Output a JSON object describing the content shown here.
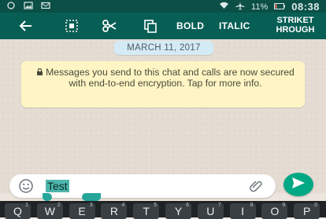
{
  "status_bar": {
    "battery_percent": "11%",
    "time": "08:38"
  },
  "action_bar": {
    "back_icon": "arrow-left-icon",
    "select_all_icon": "select-all-icon",
    "cut_icon": "scissors-icon",
    "copy_icon": "copy-icon",
    "bold_label": "BOLD",
    "italic_label": "ITALIC",
    "strikethrough_line1": "STRIKET",
    "strikethrough_line2": "HROUGH"
  },
  "chat": {
    "date_chip": "MARCH 11, 2017",
    "encryption_notice": "Messages you send to this chat and calls are now secured with end-to-end encryption. Tap for more info."
  },
  "composer": {
    "text_value": "Test",
    "emoji_icon": "emoji-icon",
    "attach_icon": "paperclip-icon",
    "send_icon": "send-icon"
  },
  "keyboard": {
    "keys": [
      {
        "label": "Q",
        "hint": "1"
      },
      {
        "label": "W",
        "hint": "2"
      },
      {
        "label": "E",
        "hint": "3"
      },
      {
        "label": "R",
        "hint": "4"
      },
      {
        "label": "T",
        "hint": "5"
      },
      {
        "label": "Y",
        "hint": "6"
      },
      {
        "label": "U",
        "hint": "7"
      },
      {
        "label": "I",
        "hint": "8"
      },
      {
        "label": "O",
        "hint": "9"
      },
      {
        "label": "P",
        "hint": "0"
      }
    ]
  },
  "colors": {
    "status_bar": "#0b4f47",
    "action_bar": "#075e54",
    "send_button": "#00a884",
    "selection": "#4db6ac",
    "notice_bg": "#fff5c4",
    "date_chip_bg": "#d4eaf4"
  }
}
